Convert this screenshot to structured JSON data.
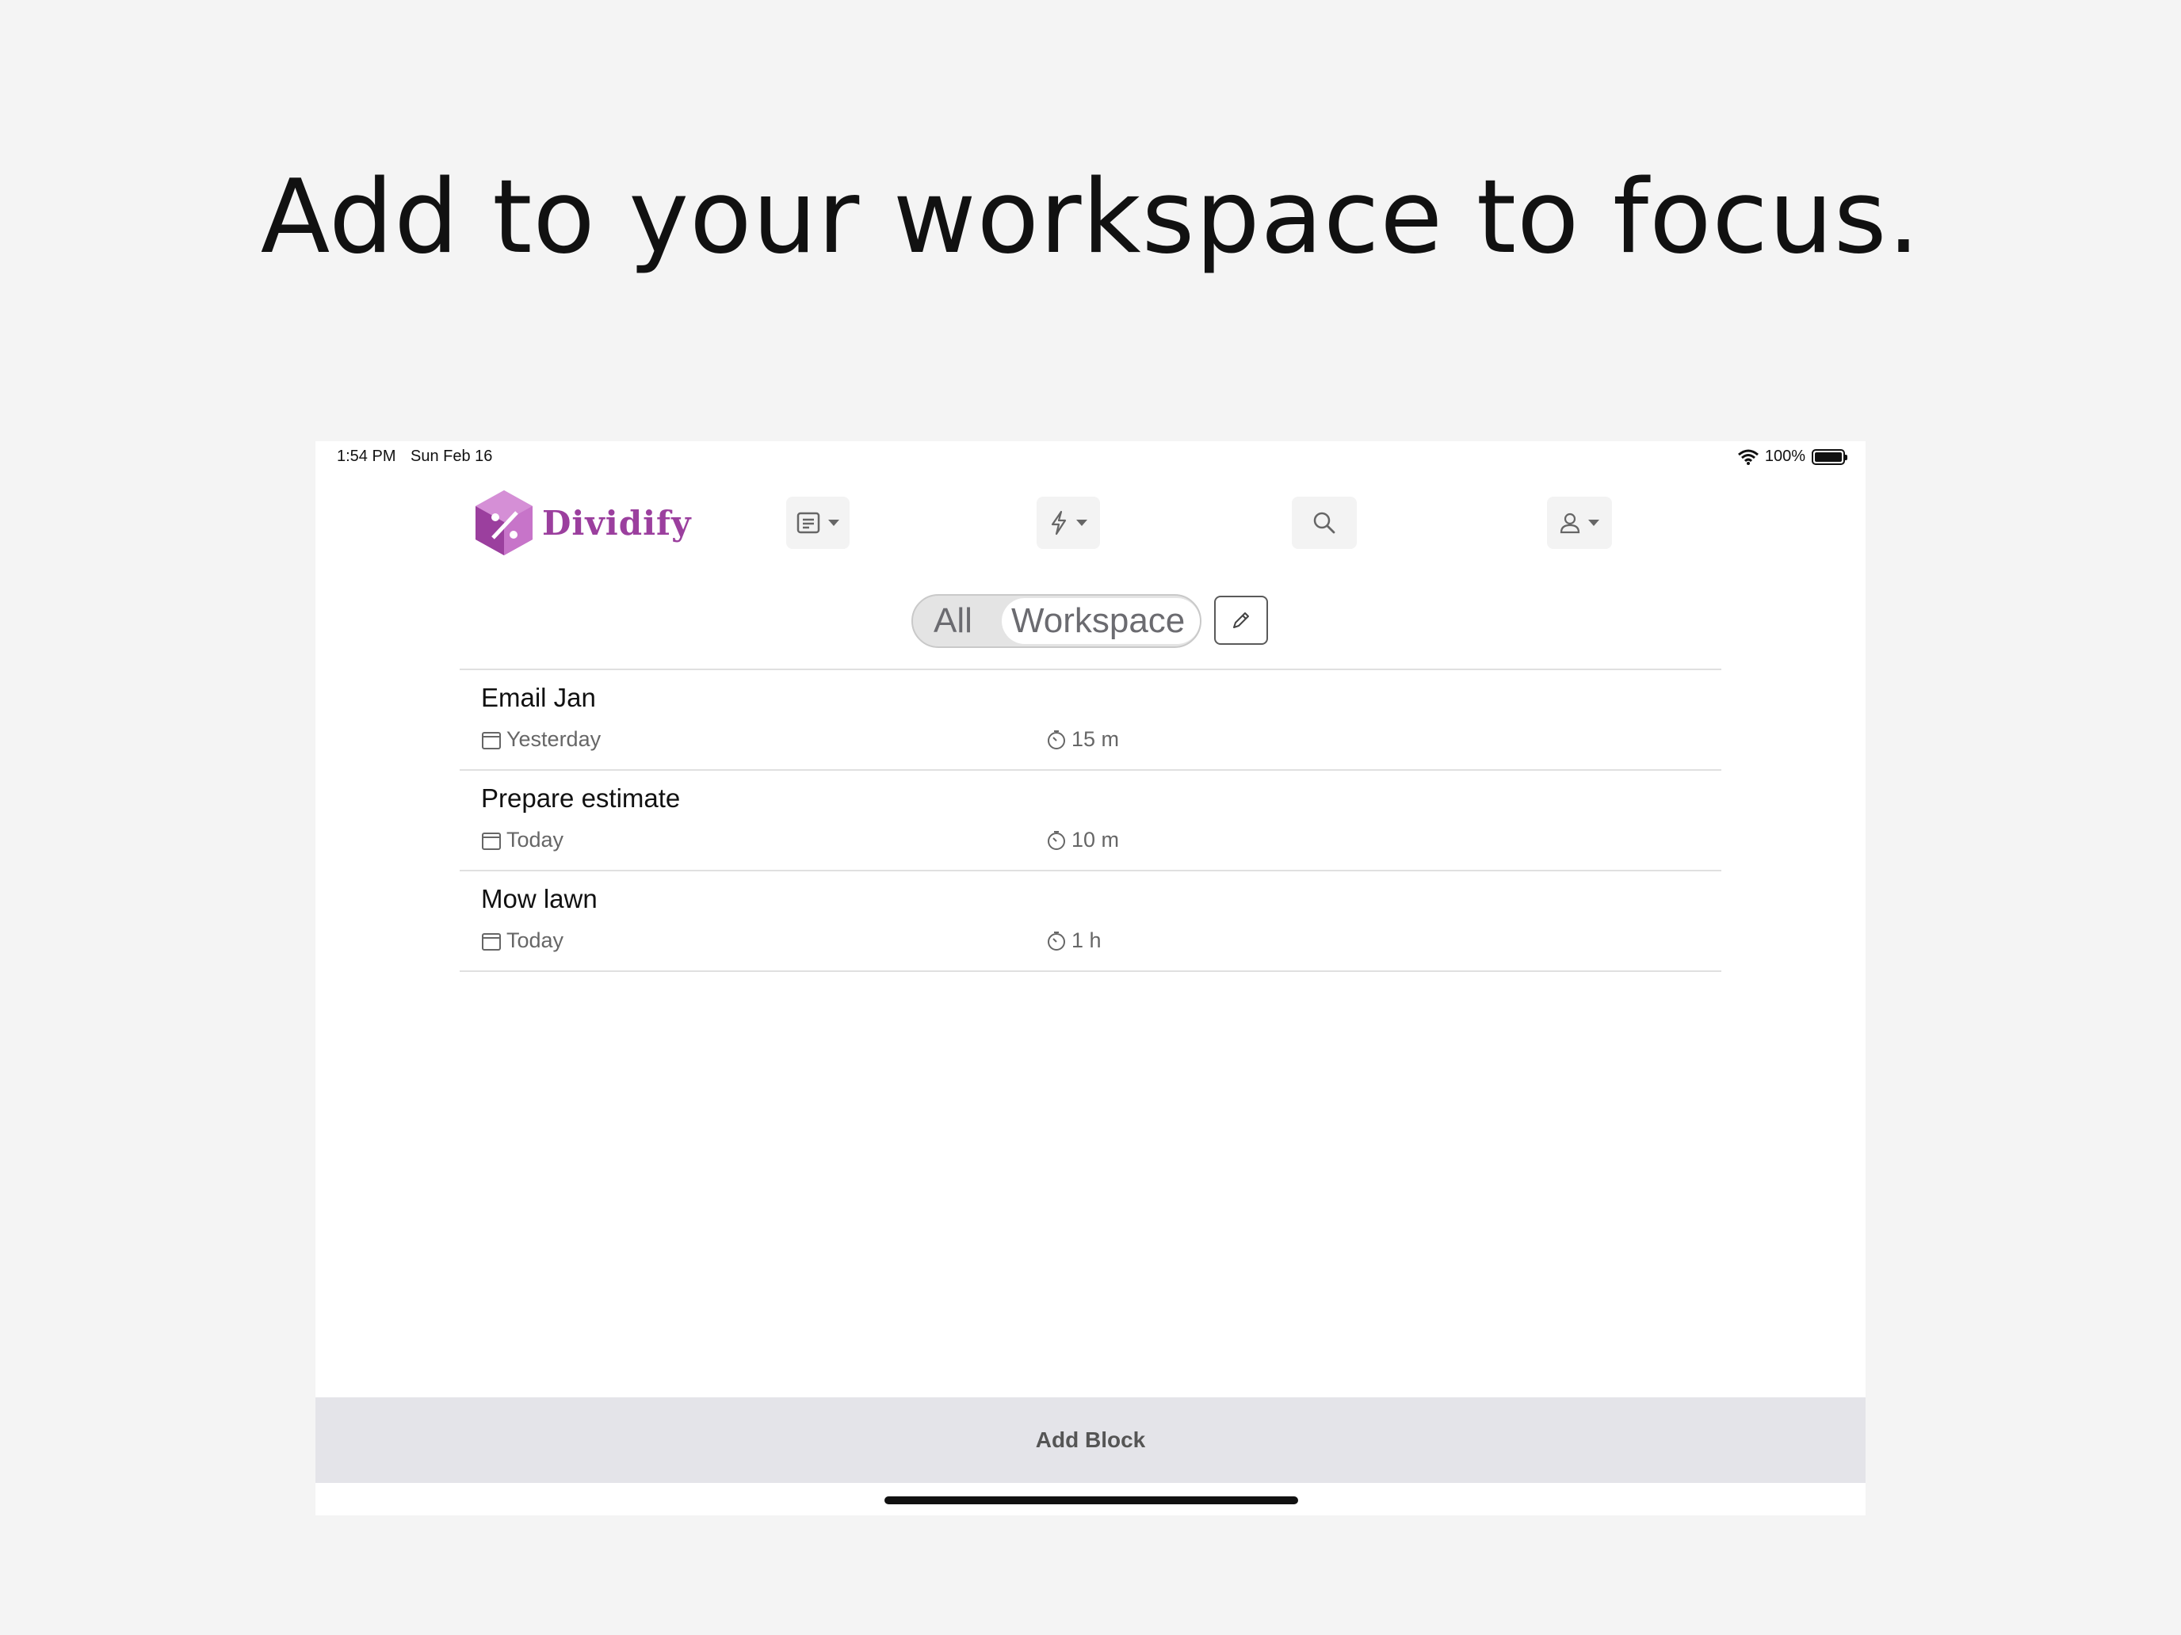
{
  "headline": "Add to your workspace to focus.",
  "statusbar": {
    "time": "1:54 PM",
    "date": "Sun Feb 16",
    "battery": "100%"
  },
  "logo": {
    "name": "Dividify",
    "mark": "%"
  },
  "nav": [
    {
      "icon": "notes-icon",
      "has_dropdown": true
    },
    {
      "icon": "lightning-icon",
      "has_dropdown": true
    },
    {
      "icon": "search-icon",
      "has_dropdown": false
    },
    {
      "icon": "user-icon",
      "has_dropdown": true
    }
  ],
  "segmented": {
    "all": "All",
    "workspace": "Workspace",
    "selected": "Workspace"
  },
  "tasks": [
    {
      "title": "Email Jan",
      "date": "Yesterday",
      "duration": "15 m"
    },
    {
      "title": "Prepare estimate",
      "date": "Today",
      "duration": "10 m"
    },
    {
      "title": "Mow lawn",
      "date": "Today",
      "duration": "1 h"
    }
  ],
  "footer": {
    "add_block": "Add Block"
  },
  "colors": {
    "brand": "#9b3f9e",
    "logo_light": "#d58fd6",
    "page_bg": "#f4f4f4",
    "bar_bg": "#e4e4e9"
  }
}
